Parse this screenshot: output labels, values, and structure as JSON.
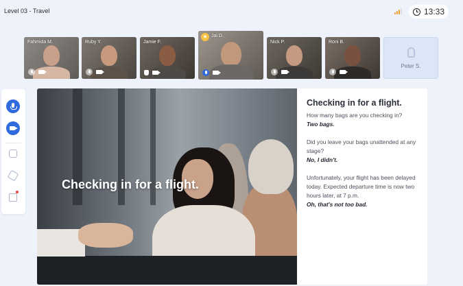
{
  "header": {
    "lesson_title": "Level 03 - Travel",
    "clock": "13:33",
    "signal_color": "#f0a030"
  },
  "participants": [
    {
      "name": "Fahmida M.",
      "mic": "muted",
      "camera": "on"
    },
    {
      "name": "Ruby Y.",
      "mic": "muted",
      "camera": "on"
    },
    {
      "name": "Jamie F.",
      "mic": "hand-raised",
      "camera": "on"
    },
    {
      "name": "Jai D.",
      "mic": "active",
      "camera": "on",
      "badge": "star-icon",
      "highlighted": true
    },
    {
      "name": "Nick P.",
      "mic": "muted",
      "camera": "on"
    },
    {
      "name": "Roni B.",
      "mic": "muted",
      "camera": "on"
    },
    {
      "name": "Peter S.",
      "mic": "off",
      "camera": "off",
      "placeholder": true
    }
  ],
  "sidebar": {
    "items": [
      {
        "icon": "microphone-icon",
        "active": true
      },
      {
        "icon": "camera-icon",
        "active": true
      },
      {
        "icon": "train-icon",
        "active": false
      },
      {
        "icon": "cube-icon",
        "active": false
      },
      {
        "icon": "chat-icon",
        "active": false,
        "notification": true
      }
    ],
    "accent": "#2f6bdc"
  },
  "lesson": {
    "video_caption": "Checking in for a flight.",
    "title": "Checking in for a flight.",
    "dialogue": [
      {
        "q": "How many bags are you checking in?",
        "a": "Two bags."
      },
      {
        "q": "Did you leave your bags unattended at any stage?",
        "a": "No, I didn't."
      },
      {
        "q": "Unfortunately, your flight has been delayed today. Expected departure time is now two hours later, at 7 p.m.",
        "a": "Oh, that's not too bad."
      }
    ]
  }
}
